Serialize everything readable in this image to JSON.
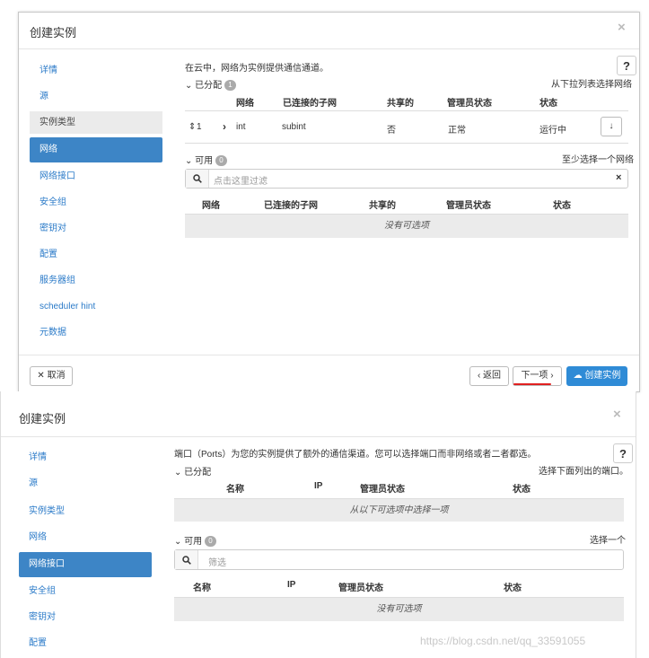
{
  "step1": {
    "title": "创建实例",
    "close": "×",
    "nav": [
      "详情",
      "源",
      "实例类型",
      "网络",
      "网络接口",
      "安全组",
      "密钥对",
      "配置",
      "服务器组",
      "scheduler hint",
      "元数据"
    ],
    "description": "在云中，网络为实例提供通信通道。",
    "help": "?",
    "allocated": {
      "label": "已分配",
      "count": "1",
      "hint": "从下拉列表选择网络"
    },
    "columns": [
      "网络",
      "已连接的子网",
      "共享的",
      "管理员状态",
      "状态"
    ],
    "allocated_rows": [
      {
        "order_icon": "⇕",
        "order": "1",
        "expand": "›",
        "network": "int",
        "subnet": "subint",
        "shared": "否",
        "admin_state": "正常",
        "status": "运行中",
        "action": "↓"
      }
    ],
    "available": {
      "label": "可用",
      "count": "0",
      "hint": "至少选择一个网络"
    },
    "filter": {
      "placeholder": "点击这里过滤",
      "clear": "×"
    },
    "empty_text": "没有可选项",
    "footer": {
      "cancel": "取消",
      "back": "‹ 返回",
      "next": "下一项 ›",
      "create": "创建实例"
    }
  },
  "step2": {
    "title": "创建实例",
    "close": "×",
    "nav": [
      "详情",
      "源",
      "实例类型",
      "网络",
      "网络接口",
      "安全组",
      "密钥对",
      "配置"
    ],
    "description": "端口（Ports）为您的实例提供了额外的通信渠道。您可以选择端口而非网络或者二者都选。",
    "help": "?",
    "allocated": {
      "label": "已分配",
      "hint": "选择下面列出的端口。"
    },
    "columns": [
      "名称",
      "IP",
      "管理员状态",
      "状态"
    ],
    "allocated_empty": "从以下可选项中选择一项",
    "available": {
      "label": "可用",
      "count": "0",
      "hint": "选择一个"
    },
    "filter": {
      "placeholder": "筛选"
    },
    "empty_text": "没有可选项"
  },
  "watermark": "https://blog.csdn.net/qq_33591055",
  "colors": {
    "accent": "#3d85c6",
    "primary_button": "#2f8bd6",
    "underline": "#e02020"
  }
}
